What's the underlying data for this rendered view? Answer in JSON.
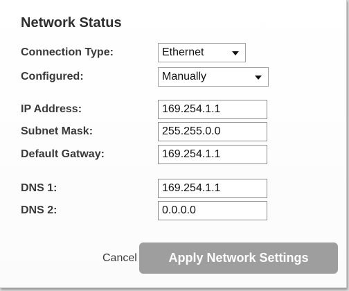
{
  "panel": {
    "title": "Network Status"
  },
  "form": {
    "connection_type": {
      "label": "Connection Type:",
      "value": "Ethernet"
    },
    "configured": {
      "label": "Configured:",
      "value": "Manually"
    },
    "ip_address": {
      "label": "IP Address:",
      "value": "169.254.1.1"
    },
    "subnet_mask": {
      "label": "Subnet Mask:",
      "value": "255.255.0.0"
    },
    "default_gateway": {
      "label": "Default Gatway:",
      "value": "169.254.1.1"
    },
    "dns1": {
      "label": "DNS 1:",
      "value": "169.254.1.1"
    },
    "dns2": {
      "label": "DNS 2:",
      "value": "0.0.0.0"
    }
  },
  "actions": {
    "cancel_label": "Cancel",
    "apply_label": "Apply Network Settings"
  },
  "colors": {
    "apply_button_bg": "#9e9e9e",
    "label_text": "#3a3a3a"
  },
  "icons": {
    "dropdown": "chevron-down-icon"
  }
}
